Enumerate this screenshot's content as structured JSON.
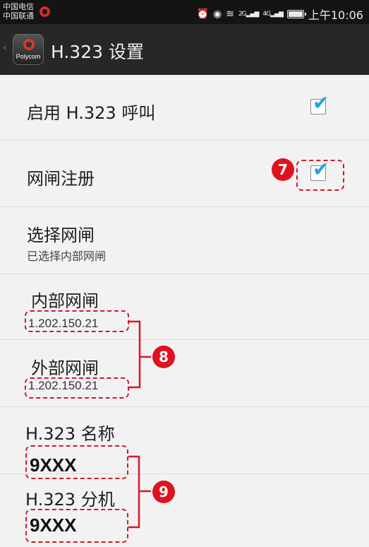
{
  "status_bar": {
    "carrier_1": "中国电信",
    "carrier_2": "中国联通",
    "icons": [
      "alarm-icon",
      "eye-icon",
      "wifi-icon",
      "signal-2g-icon",
      "signal-4g-icon",
      "battery-icon"
    ],
    "sig_label_1": "2G",
    "sig_label_2": "4G",
    "time": "上午10:06"
  },
  "action_bar": {
    "app_brand": "Polycom",
    "title": "H.323 设置"
  },
  "settings": {
    "enable_h323": {
      "label": "启用 H.323 呼叫",
      "checked": true
    },
    "gatekeeper_registration": {
      "label": "网闸注册",
      "checked": true
    },
    "select_gatekeeper": {
      "label": "选择网闸",
      "summary": "已选择内部网闸"
    },
    "internal_gatekeeper": {
      "label": "内部网闸",
      "value": "1.202.150.21"
    },
    "external_gatekeeper": {
      "label": "外部网闸",
      "value": "1.202.150.21"
    },
    "h323_name": {
      "label": "H.323 名称",
      "value": "9XXX"
    },
    "h323_extension": {
      "label": "H.323 分机",
      "value": "9XXX"
    }
  },
  "annotations": {
    "badge_7": "7",
    "badge_8": "8",
    "badge_9": "9",
    "color": "#e0121f"
  },
  "colors": {
    "accent_check": "#27a0e6",
    "action_bar": "#272727",
    "background": "#f2f2f2"
  }
}
